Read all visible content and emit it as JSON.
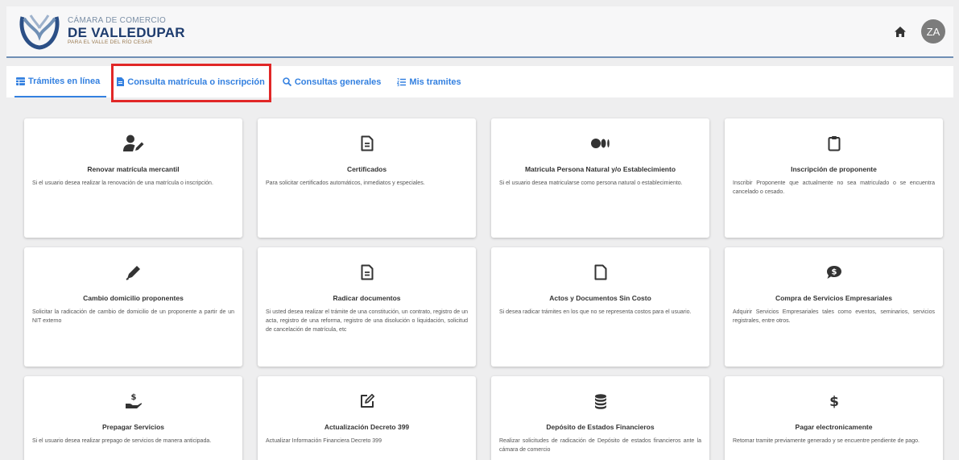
{
  "header": {
    "logo": {
      "line1": "CÁMARA DE COMERCIO",
      "line2": "DE VALLEDUPAR",
      "line3": "PARA EL VALLE DEL RÍO CESAR"
    },
    "avatar_initials": "ZA",
    "icons": {
      "home": "home-icon"
    }
  },
  "tabs": [
    {
      "label": "Trámites en línea",
      "icon": "table-icon",
      "active": true
    },
    {
      "label": "Consulta matrícula o inscripción",
      "icon": "file-icon",
      "active": false
    },
    {
      "label": "Consultas generales",
      "icon": "search-icon",
      "active": false
    },
    {
      "label": "Mis tramites",
      "icon": "list-icon",
      "active": false
    }
  ],
  "cards": [
    {
      "icon": "user-edit-icon",
      "title": "Renovar matrícula mercantil",
      "desc": "Si el usuario desea realizar la renovación de una matrícula o inscripción."
    },
    {
      "icon": "document-icon",
      "title": "Certificados",
      "desc": "Para solicitar certificados automáticos, inmediatos y especiales."
    },
    {
      "icon": "circles-icon",
      "title": "Matricula Persona Natural y/o Establecimiento",
      "desc": "Si el usuario desea matricularse como persona natural o establecimiento."
    },
    {
      "icon": "clipboard-icon",
      "title": "Inscripción de proponente",
      "desc": "Inscribir Proponente que actualmente no sea matriculado o se encuentra cancelado o cesado."
    },
    {
      "icon": "marker-icon",
      "title": "Cambio domicilio proponentes",
      "desc": "Solicitar la radicación de cambio de domicilio de un proponente a partir de un NIT externo"
    },
    {
      "icon": "document-icon",
      "title": "Radicar documentos",
      "desc": "Si usted desea realizar el trámite de una constitución, un contrato, registro de un acta, registro de una reforma, registro de una disolución o liquidación, solicitud de cancelación de matrícula, etc"
    },
    {
      "icon": "blank-file-icon",
      "title": "Actos y Documentos Sin Costo",
      "desc": "Si desea radicar trámites en los que no se representa costos para el usuario."
    },
    {
      "icon": "dollar-comment-icon",
      "title": "Compra de Servicios Empresariales",
      "desc": "Adquirir Servicios Empresariales tales como eventos, seminarios, servicios registrales, entre otros."
    },
    {
      "icon": "hand-dollar-icon",
      "title": "Prepagar Servicios",
      "desc": "Si el usuario desea realizar prepago de servicios de manera anticipada."
    },
    {
      "icon": "edit-icon",
      "title": "Actualización Decreto 399",
      "desc": "Actualizar Información Financiera Decreto 399"
    },
    {
      "icon": "coins-icon",
      "title": "Depósito de Estados Financieros",
      "desc": "Realizar solicitudes de radicación de Depósito de estados financieros ante la cámara de comercio"
    },
    {
      "icon": "dollar-icon",
      "title": "Pagar electronicamente",
      "desc": "Retomar tramite previamente generado y se encuentre pendiente de pago."
    }
  ],
  "colors": {
    "accent": "#3380e0",
    "highlight": "#e12727",
    "brand": "#1e3c6e"
  }
}
